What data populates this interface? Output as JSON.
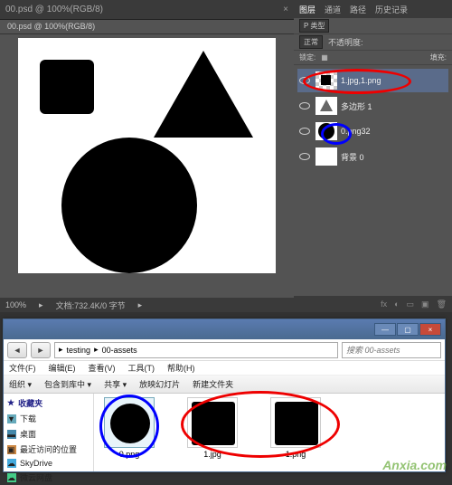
{
  "ps": {
    "title": "00.psd @ 100%(RGB/8)",
    "tab": "00.psd @ 100%(RGB/8)",
    "zoom": "100%",
    "docinfo": "文档:732.4K/0 字节",
    "panel_tabs": [
      "图层",
      "通道",
      "路径",
      "历史记录"
    ],
    "blend_mode": "正常",
    "opacity_label": "不透明度:",
    "lock_label": "锁定:",
    "fill_label": "填充:",
    "kind": "P 类型",
    "layers": [
      {
        "name": "1.jpg,1.png"
      },
      {
        "name": "多边形 1"
      },
      {
        "name": "0.png32"
      },
      {
        "name": "背景 0"
      }
    ]
  },
  "explorer": {
    "crumbs": [
      "testing",
      "00-assets"
    ],
    "search_placeholder": "搜索 00-assets",
    "menu": [
      "文件(F)",
      "编辑(E)",
      "查看(V)",
      "工具(T)",
      "帮助(H)"
    ],
    "toolbar": [
      "组织 ▾",
      "包含到库中 ▾",
      "共享 ▾",
      "放映幻灯片",
      "新建文件夹"
    ],
    "sidebar": {
      "fav": "收藏夹",
      "items": [
        "下载",
        "桌面",
        "最近访问的位置",
        "SkyDrive",
        "微云网盘"
      ]
    },
    "files": [
      {
        "name": "0.png",
        "shape": "circle",
        "selected": true
      },
      {
        "name": "1.jpg",
        "shape": "square",
        "selected": false
      },
      {
        "name": "1.png",
        "shape": "square",
        "selected": false
      }
    ]
  },
  "watermark": "Anxia.com"
}
